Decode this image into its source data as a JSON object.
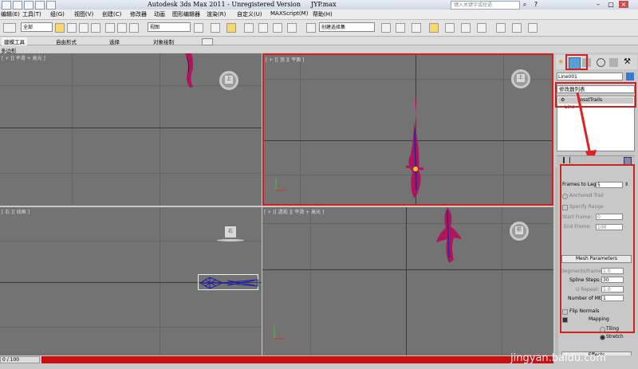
{
  "window": {
    "title": "Autodesk 3ds Max  2011  - Unregistered Version",
    "file": "JYP.max",
    "search_placeholder": "键入关键字或短语"
  },
  "menubar": [
    "编辑(E)",
    "工具(T)",
    "组(G)",
    "视图(V)",
    "创建(C)",
    "修改器",
    "动画",
    "图形编辑器",
    "渲染(R)",
    "自定义(U)",
    "MAXScript(M)",
    "帮助(H)"
  ],
  "toolbar": {
    "selection_filter": "全部",
    "reference_coord": "视图",
    "named_selection": "创建选择集"
  },
  "ribbon": {
    "tabs": [
      "建模工具",
      "自由形式",
      "选择",
      "对象绘制"
    ],
    "row2": "多边形"
  },
  "viewports": {
    "top_left": "[ + ][ 平滑 + 高光 ]",
    "top_right": "[ + ][ 顶 ][ 平面 ]",
    "bottom_left": "[ 右 ][ 线框 ]",
    "bottom_right": "[ + ][ 透视 ][ 平滑 + 高光 ]",
    "viewcube_top_left": "上",
    "viewcube_top_right": "上",
    "viewcube_bottom_left": "右",
    "viewcube_bottom_right": "前"
  },
  "command_panel": {
    "object_name": "Line001",
    "modifier_list": "修改器列表",
    "stack": [
      "PosstTrails",
      "Line"
    ],
    "frames_to_lag_label": "Frames to Lag:",
    "frames_to_lag": "5",
    "anchored_trail": "Anchored Trail",
    "specify_range": "Specify Range",
    "start_frame_label": "Start Frame:",
    "start_frame": "0",
    "end_frame_label": "End Frame:",
    "end_frame": "100",
    "mesh_params": "Mesh Parameters",
    "segments_label": "Segments/frame:",
    "segments": "1.0",
    "spline_steps_label": "Spline Steps:",
    "spline_steps": "30",
    "u_repeat_label": "U Repeat:",
    "u_repeat": "1.0",
    "mtls_label": "Number of Mtls:",
    "mtls": "1",
    "flip_normals": "Flip Normals",
    "mapping": "Mapping",
    "tiling": "Tiling",
    "stretch": "Stretch",
    "effects": "Effects"
  },
  "timeline": {
    "frame": "0 / 100"
  },
  "watermark": {
    "logo": "Bai du 经验",
    "url": "jingyan.baidu.com"
  },
  "colors": {
    "viewport_bg": "#737373",
    "highlight_red": "#d02020",
    "object_magenta": "#b0145a"
  }
}
